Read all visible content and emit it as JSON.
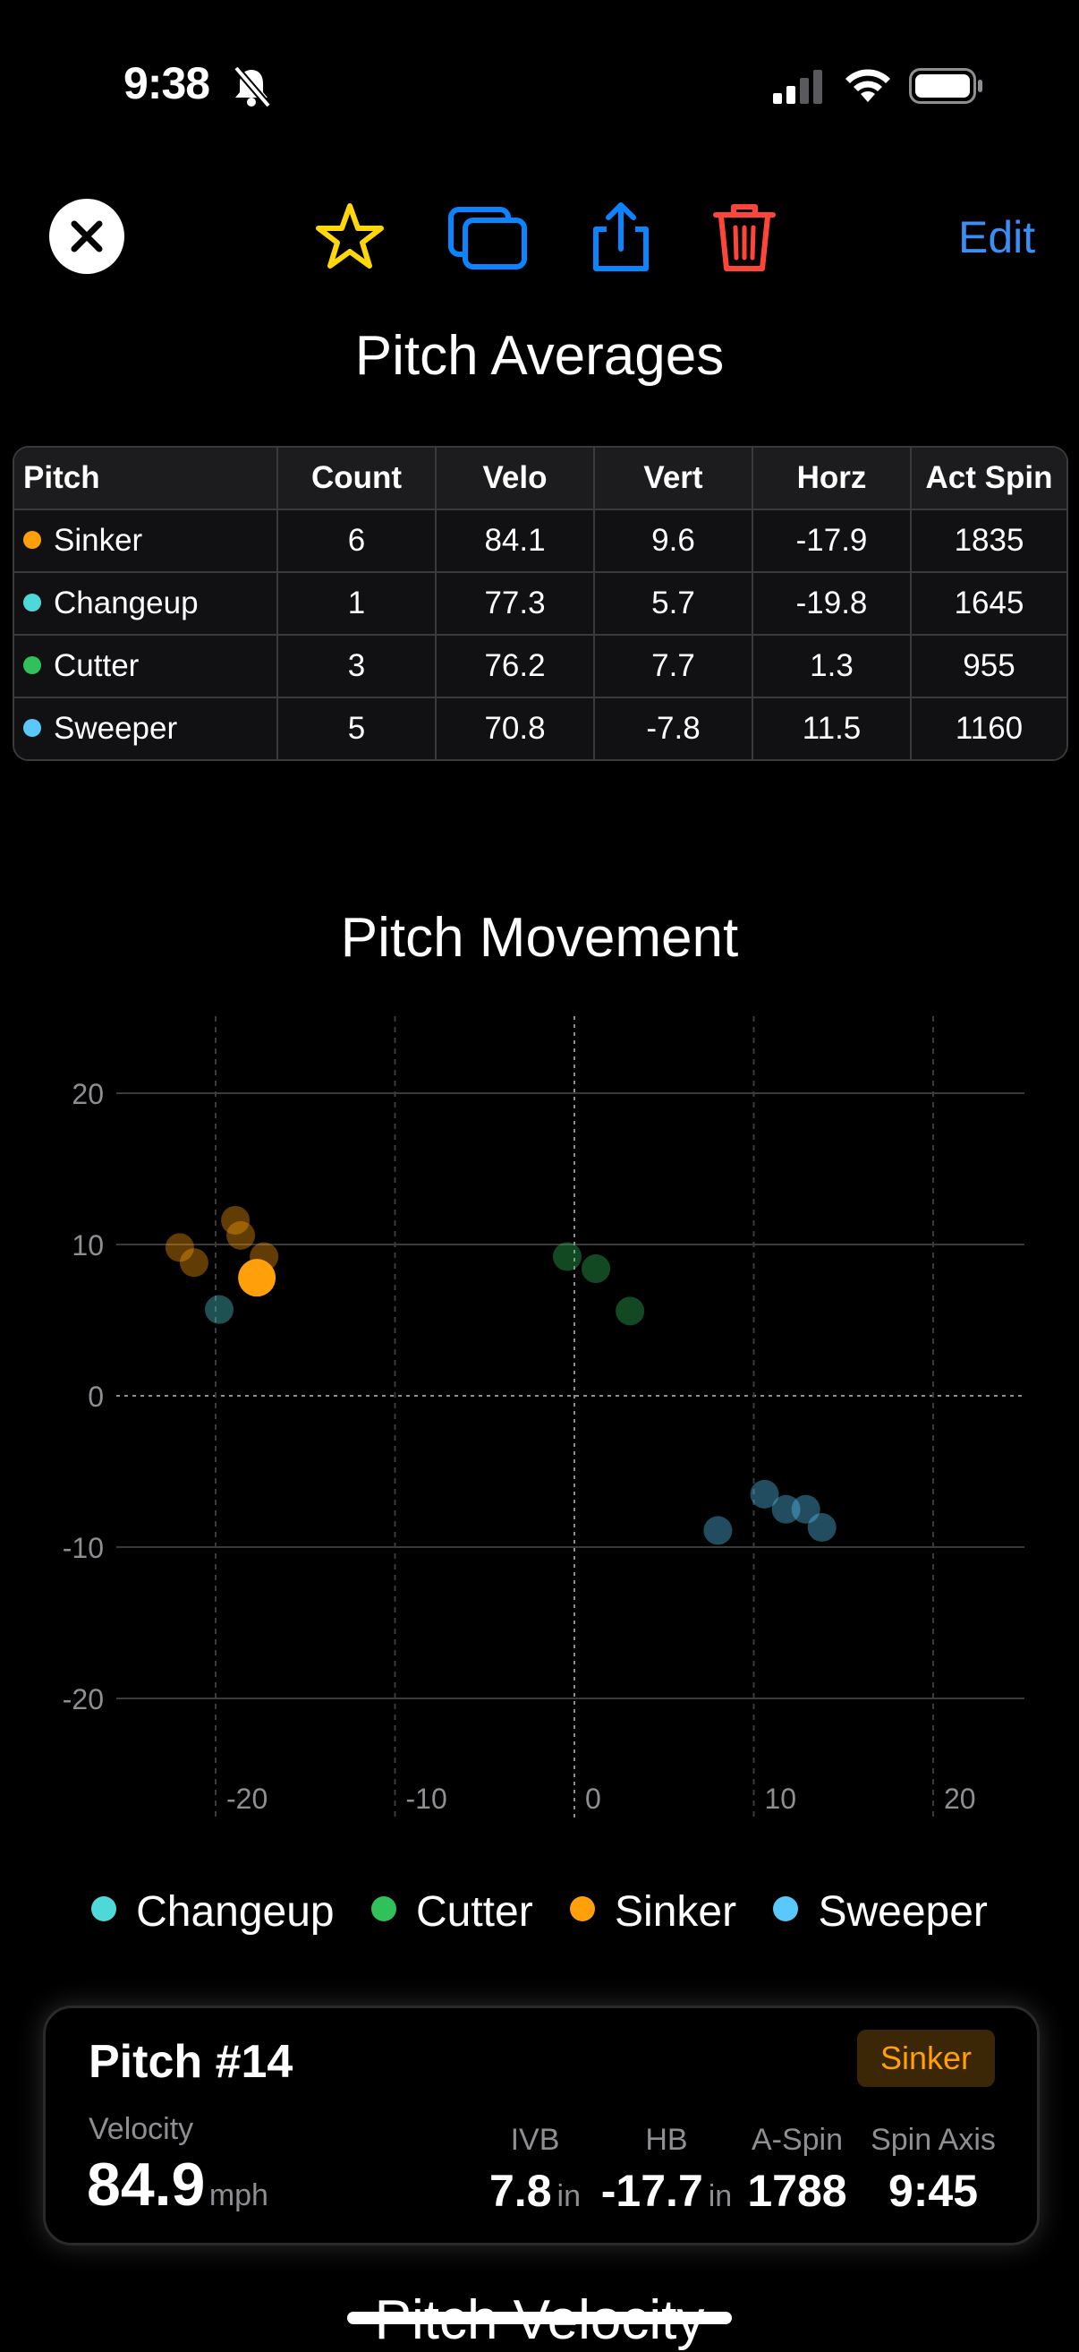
{
  "status_bar": {
    "time": "9:38"
  },
  "toolbar": {
    "edit_label": "Edit"
  },
  "averages": {
    "title": "Pitch Averages",
    "columns": [
      "Pitch",
      "Count",
      "Velo",
      "Vert",
      "Horz",
      "Act Spin"
    ],
    "rows": [
      {
        "pitch": "Sinker",
        "color": "#ff9f0a",
        "count": "6",
        "velo": "84.1",
        "vert": "9.6",
        "horz": "-17.9",
        "spin": "1835"
      },
      {
        "pitch": "Changeup",
        "color": "#4fd8d8",
        "count": "1",
        "velo": "77.3",
        "vert": "5.7",
        "horz": "-19.8",
        "spin": "1645"
      },
      {
        "pitch": "Cutter",
        "color": "#30c15a",
        "count": "3",
        "velo": "76.2",
        "vert": "7.7",
        "horz": "1.3",
        "spin": "955"
      },
      {
        "pitch": "Sweeper",
        "color": "#5ac8fa",
        "count": "5",
        "velo": "70.8",
        "vert": "-7.8",
        "horz": "11.5",
        "spin": "1160"
      }
    ]
  },
  "movement": {
    "title": "Pitch Movement",
    "legend": [
      {
        "label": "Changeup",
        "color": "#4fd8d8"
      },
      {
        "label": "Cutter",
        "color": "#30c15a"
      },
      {
        "label": "Sinker",
        "color": "#ff9f0a"
      },
      {
        "label": "Sweeper",
        "color": "#5ac8fa"
      }
    ]
  },
  "chart_data": {
    "type": "scatter",
    "title": "Pitch Movement",
    "xlim": [
      -25,
      25
    ],
    "ylim": [
      -25,
      25
    ],
    "x_ticks": [
      -20,
      -10,
      0,
      10,
      20
    ],
    "y_ticks": [
      20,
      10,
      0,
      -10,
      -20
    ],
    "grid": true,
    "legend_position": "bottom",
    "series": [
      {
        "name": "Sinker",
        "color": "#ff9f0a",
        "points": [
          [
            -22,
            9.8
          ],
          [
            -21.2,
            8.8
          ],
          [
            -18.9,
            11.6
          ],
          [
            -18.6,
            10.6
          ],
          [
            -17.3,
            9.2
          ]
        ]
      },
      {
        "name": "Changeup",
        "color": "#4fd8d8",
        "points": [
          [
            -19.8,
            5.7
          ]
        ]
      },
      {
        "name": "Cutter",
        "color": "#30c15a",
        "points": [
          [
            -0.4,
            9.2
          ],
          [
            1.2,
            8.4
          ],
          [
            3.1,
            5.6
          ]
        ]
      },
      {
        "name": "Sweeper",
        "color": "#5ac8fa",
        "points": [
          [
            8,
            -8.9
          ],
          [
            10.6,
            -6.5
          ],
          [
            11.8,
            -7.5
          ],
          [
            12.9,
            -7.5
          ],
          [
            13.8,
            -8.7
          ]
        ]
      }
    ],
    "highlight": {
      "name": "Sinker",
      "color": "#ff9f0a",
      "x": -17.7,
      "y": 7.8
    }
  },
  "selected_pitch": {
    "title": "Pitch #14",
    "type_badge": "Sinker",
    "velocity_label": "Velocity",
    "velocity_value": "84.9",
    "velocity_unit": "mph",
    "metrics": [
      {
        "label": "IVB",
        "value": "7.8",
        "unit": "in"
      },
      {
        "label": "HB",
        "value": "-17.7",
        "unit": "in"
      },
      {
        "label": "A-Spin",
        "value": "1788",
        "unit": ""
      },
      {
        "label": "Spin Axis",
        "value": "9:45",
        "unit": ""
      }
    ]
  },
  "next_section": {
    "title": "Pitch Velocity"
  }
}
